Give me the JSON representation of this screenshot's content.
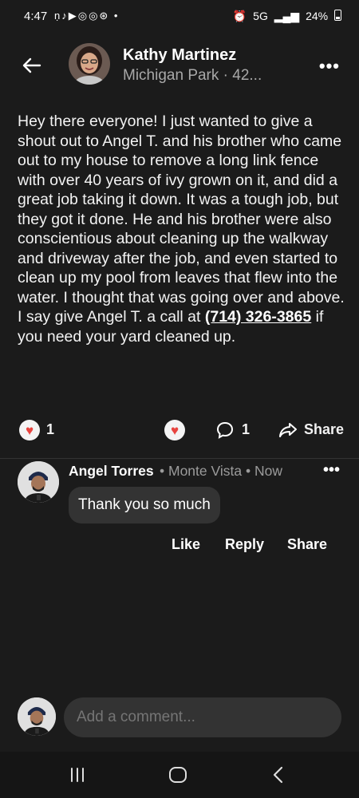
{
  "status": {
    "time": "4:47",
    "network": "5G",
    "battery": "24%"
  },
  "header": {
    "name": "Kathy Martinez",
    "subtitle": "Michigan Park · 42..."
  },
  "post": {
    "text_before_phone": "Hey there everyone! I just wanted to give a shout out to Angel T. and his brother who came out to my house to remove a long link fence with over 40 years of ivy grown on it, and did a great job taking it down.  It was a tough job, but they got it done.  He and his brother were also conscientious about cleaning up the walkway and driveway after the job, and even started to clean up my pool from leaves that flew into the water.  I thought that was going over and above.  I say give Angel T. a call at ",
    "phone": "(714) 326-3865",
    "text_after_phone": " if you need your yard cleaned up."
  },
  "reactions": {
    "like_count": "1",
    "comment_count": "1",
    "share_label": "Share"
  },
  "comment": {
    "author": "Angel Torres",
    "location": "Monte Vista",
    "time": "Now",
    "text": "Thank you so much",
    "like_label": "Like",
    "reply_label": "Reply",
    "share_label": "Share"
  },
  "composer": {
    "placeholder": "Add a comment..."
  },
  "colors": {
    "background": "#1b1b1b",
    "heart": "#e8443f"
  }
}
